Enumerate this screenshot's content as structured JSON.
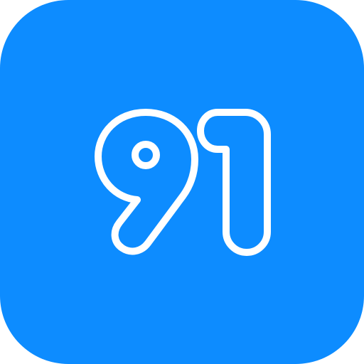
{
  "icon": {
    "name": "number-91-icon",
    "number_text": "91",
    "background_color": "#0D8CFF",
    "outline_color": "#FFFFFF"
  }
}
